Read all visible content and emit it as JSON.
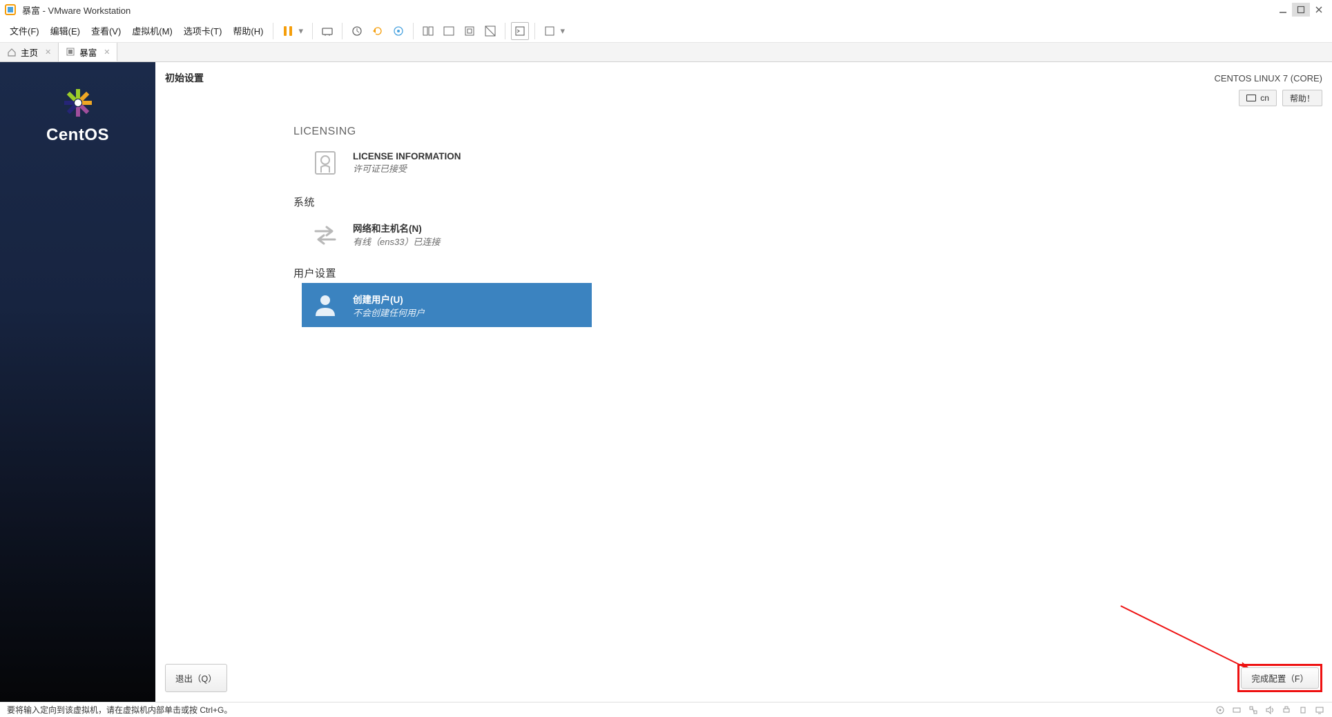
{
  "window": {
    "title": "暴富 - VMware Workstation"
  },
  "menu": {
    "file": "文件(F)",
    "edit": "编辑(E)",
    "view": "查看(V)",
    "vm": "虚拟机(M)",
    "tabs": "选项卡(T)",
    "help": "帮助(H)"
  },
  "tabs": {
    "home": "主页",
    "vm": "暴富"
  },
  "centos": {
    "brand": "CentOS",
    "setup_title": "初始设置",
    "os_label": "CENTOS LINUX 7 (CORE)",
    "keyboard_layout": "cn",
    "help_btn": "帮助！",
    "section_licensing": "LICENSING",
    "license_title": "LICENSE INFORMATION",
    "license_sub": "许可证已接受",
    "section_system": "系统",
    "network_title": "网络和主机名(N)",
    "network_sub": "有线（ens33）已连接",
    "section_user": "用户设置",
    "user_title": "创建用户(U)",
    "user_sub": "不会创建任何用户",
    "quit_btn": "退出（Q）",
    "finish_btn": "完成配置（F）"
  },
  "status": {
    "hint": "要将输入定向到该虚拟机，请在虚拟机内部单击或按 Ctrl+G。"
  }
}
